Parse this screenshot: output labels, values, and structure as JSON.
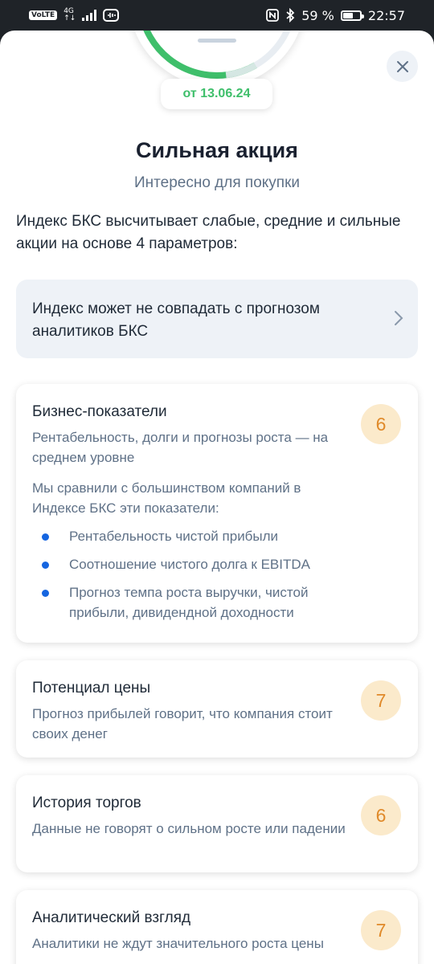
{
  "status_bar": {
    "volte": "VoLTE",
    "net_top": "4G",
    "net_bottom": "↑↓",
    "battery_text": "59 %",
    "battery_level_percent": 59,
    "time": "22:57",
    "icons": [
      "nfc-icon",
      "bluetooth-icon",
      "battery-icon",
      "signal-icon",
      "hotspot-icon"
    ]
  },
  "header": {
    "gauge_color": "#3fbf6b",
    "date": "от 13.06.24",
    "title": "Сильная акция",
    "subtitle": "Интересно для покупки",
    "intro": "Индекс БКС высчитывает слабые, средние и сильные акции на основе 4 параметров:"
  },
  "info_card": {
    "text": "Индекс может не совпадать с прогнозом аналитиков БКС"
  },
  "cards": [
    {
      "title": "Бизнес-показатели",
      "desc": "Рентабельность, долги и прогнозы роста — на среднем уровне",
      "score": "6",
      "note": "Мы сравнили с большинством компаний в Индексе БКС эти показатели:",
      "items": [
        "Рентабельность чистой прибыли",
        "Соотношение чистого долга к EBITDA",
        "Прогноз темпа роста выручки, чистой прибыли, дивидендной доходности"
      ]
    },
    {
      "title": "Потенциал цены",
      "desc": "Прогноз прибылей говорит, что компания стоит своих денег",
      "score": "7"
    },
    {
      "title": "История торгов",
      "desc": "Данные не говорят о сильном росте или падении",
      "score": "6"
    },
    {
      "title": "Аналитический взгляд",
      "desc": "Аналитики не ждут значительного роста цены",
      "score": "7"
    }
  ],
  "colors": {
    "accent_green": "#3fbf6b",
    "score_bg": "#fbeacb",
    "score_text": "#e08a2a",
    "bullet": "#1565e0"
  }
}
